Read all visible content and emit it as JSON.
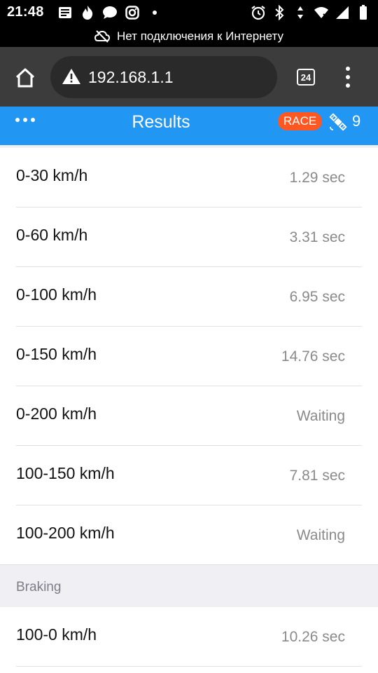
{
  "status_bar": {
    "time": "21:48",
    "left_icons": [
      "news-icon",
      "fire-icon",
      "chat-icon",
      "instagram-icon",
      "dot-icon"
    ],
    "right_icons": [
      "alarm-icon",
      "bluetooth-icon",
      "data-arrows-icon",
      "wifi-off-icon",
      "signal-icon",
      "battery-icon"
    ]
  },
  "offline_banner": {
    "text": "Нет подключения к Интернету",
    "icon": "cloud-off-icon"
  },
  "browser": {
    "url": "192.168.1.1",
    "tab_count": "24"
  },
  "app_header": {
    "title": "Results",
    "mode_badge": "RACE",
    "satellites": "9",
    "accent": "#2196f3",
    "badge_color": "#ff5722"
  },
  "acceleration": [
    {
      "label": "0-30 km/h",
      "value": "1.29 sec"
    },
    {
      "label": "0-60 km/h",
      "value": "3.31 sec"
    },
    {
      "label": "0-100 km/h",
      "value": "6.95 sec"
    },
    {
      "label": "0-150 km/h",
      "value": "14.76 sec"
    },
    {
      "label": "0-200 km/h",
      "value": "Waiting"
    },
    {
      "label": "100-150 km/h",
      "value": "7.81 sec"
    },
    {
      "label": "100-200 km/h",
      "value": "Waiting"
    }
  ],
  "braking": {
    "title": "Braking",
    "rows": [
      {
        "label": "100-0 km/h",
        "value": "10.26 sec"
      }
    ]
  }
}
